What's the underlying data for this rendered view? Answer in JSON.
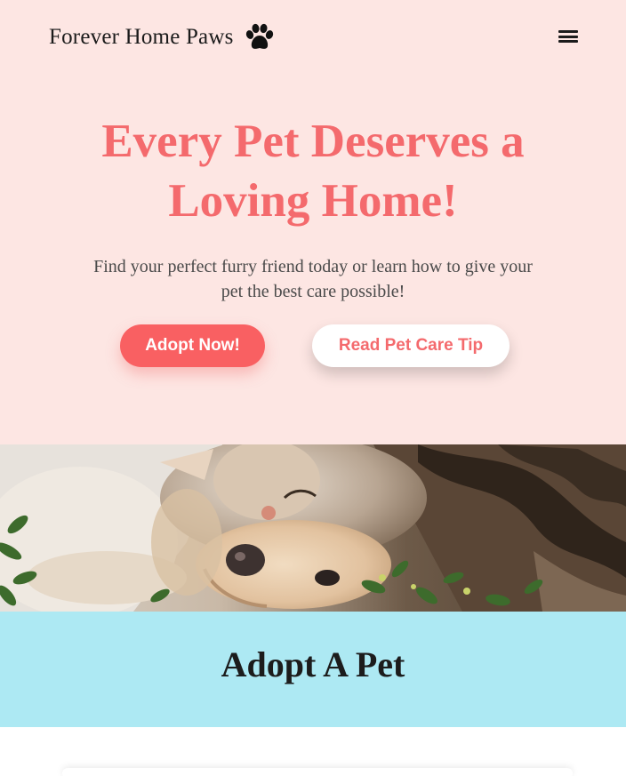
{
  "header": {
    "brand": "Forever Home Paws",
    "brand_icon": "paw-icon",
    "menu_icon": "hamburger-menu-icon",
    "background": "#fde6e3"
  },
  "hero": {
    "title": "Every Pet Deserves a Loving Home!",
    "subtitle": "Find your perfect furry friend today or learn how to give your pet the best care possible!",
    "primary_button": "Adopt Now!",
    "secondary_button": "Read Pet Care Tip",
    "accent_color": "#f46a6d",
    "primary_button_color": "#f96062"
  },
  "photo": {
    "subject": "cat and dog cuddling"
  },
  "adopt_section": {
    "title": "Adopt A Pet",
    "background": "#ade9f3"
  }
}
